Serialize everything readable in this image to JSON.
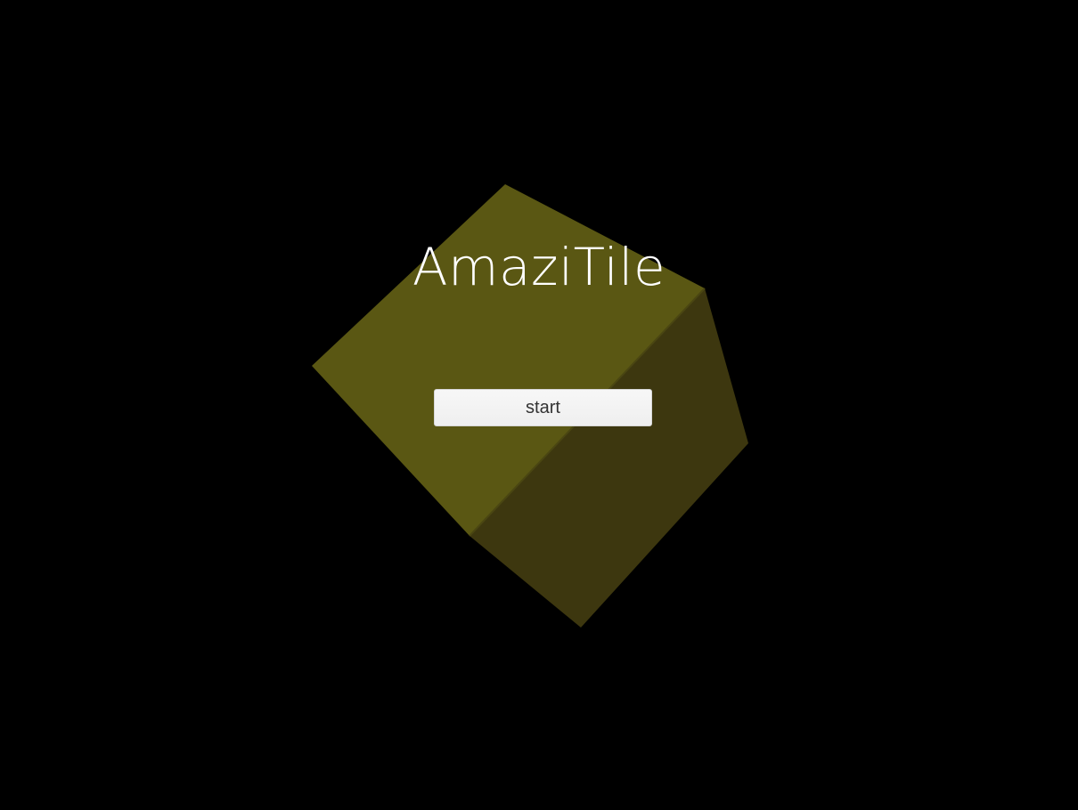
{
  "game": {
    "title": "AmaziTile",
    "start_label": "start"
  },
  "cube": {
    "icon": "rotating-cube-icon",
    "colors": {
      "front_face": "#5a5713",
      "side_face": "#3d370f",
      "edge_highlight": "#65611a"
    }
  },
  "colors": {
    "background": "#000000",
    "title_text": "#ffffff",
    "button_bg": "#f3f3f3",
    "button_text": "#333333"
  }
}
